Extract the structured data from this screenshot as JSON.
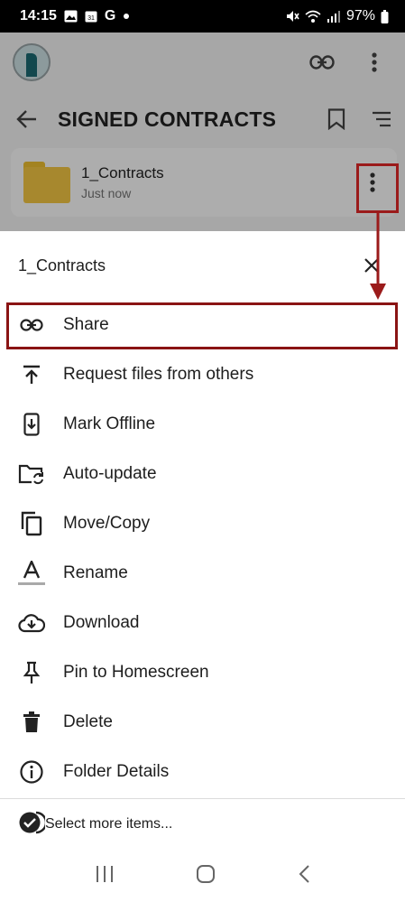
{
  "status_bar": {
    "time": "14:15",
    "status_icons": [
      "image-icon",
      "calendar-icon",
      "google-icon",
      "dot-icon"
    ],
    "system_icons": [
      "mute-icon",
      "wifi-icon",
      "signal-icon"
    ],
    "battery": "97%"
  },
  "header": {
    "icons": [
      "avatar",
      "link-icon",
      "more-vert-icon"
    ]
  },
  "title_bar": {
    "title": "SIGNED CONTRACTS",
    "icons": [
      "back-arrow-icon",
      "bookmark-icon",
      "sort-icon"
    ]
  },
  "folder": {
    "name": "1_Contracts",
    "modified": "Just now"
  },
  "sheet": {
    "title": "1_Contracts",
    "items": [
      {
        "label": "Share",
        "icon": "link-icon"
      },
      {
        "label": "Request files from others",
        "icon": "upload-icon"
      },
      {
        "label": "Mark Offline",
        "icon": "offline-icon"
      },
      {
        "label": "Auto-update",
        "icon": "folder-sync-icon"
      },
      {
        "label": "Move/Copy",
        "icon": "copy-icon"
      },
      {
        "label": "Rename",
        "icon": "rename-icon"
      },
      {
        "label": "Download",
        "icon": "cloud-download-icon"
      },
      {
        "label": "Pin to Homescreen",
        "icon": "pin-icon"
      },
      {
        "label": "Delete",
        "icon": "trash-icon"
      },
      {
        "label": "Folder Details",
        "icon": "info-icon"
      }
    ],
    "footer_label": "Select more items...",
    "footer_icon": "check-circle-icon"
  },
  "nav_bar": {
    "icons": [
      "recents-icon",
      "home-icon",
      "back-icon"
    ]
  },
  "annotation": {
    "color": "#8a1414"
  }
}
